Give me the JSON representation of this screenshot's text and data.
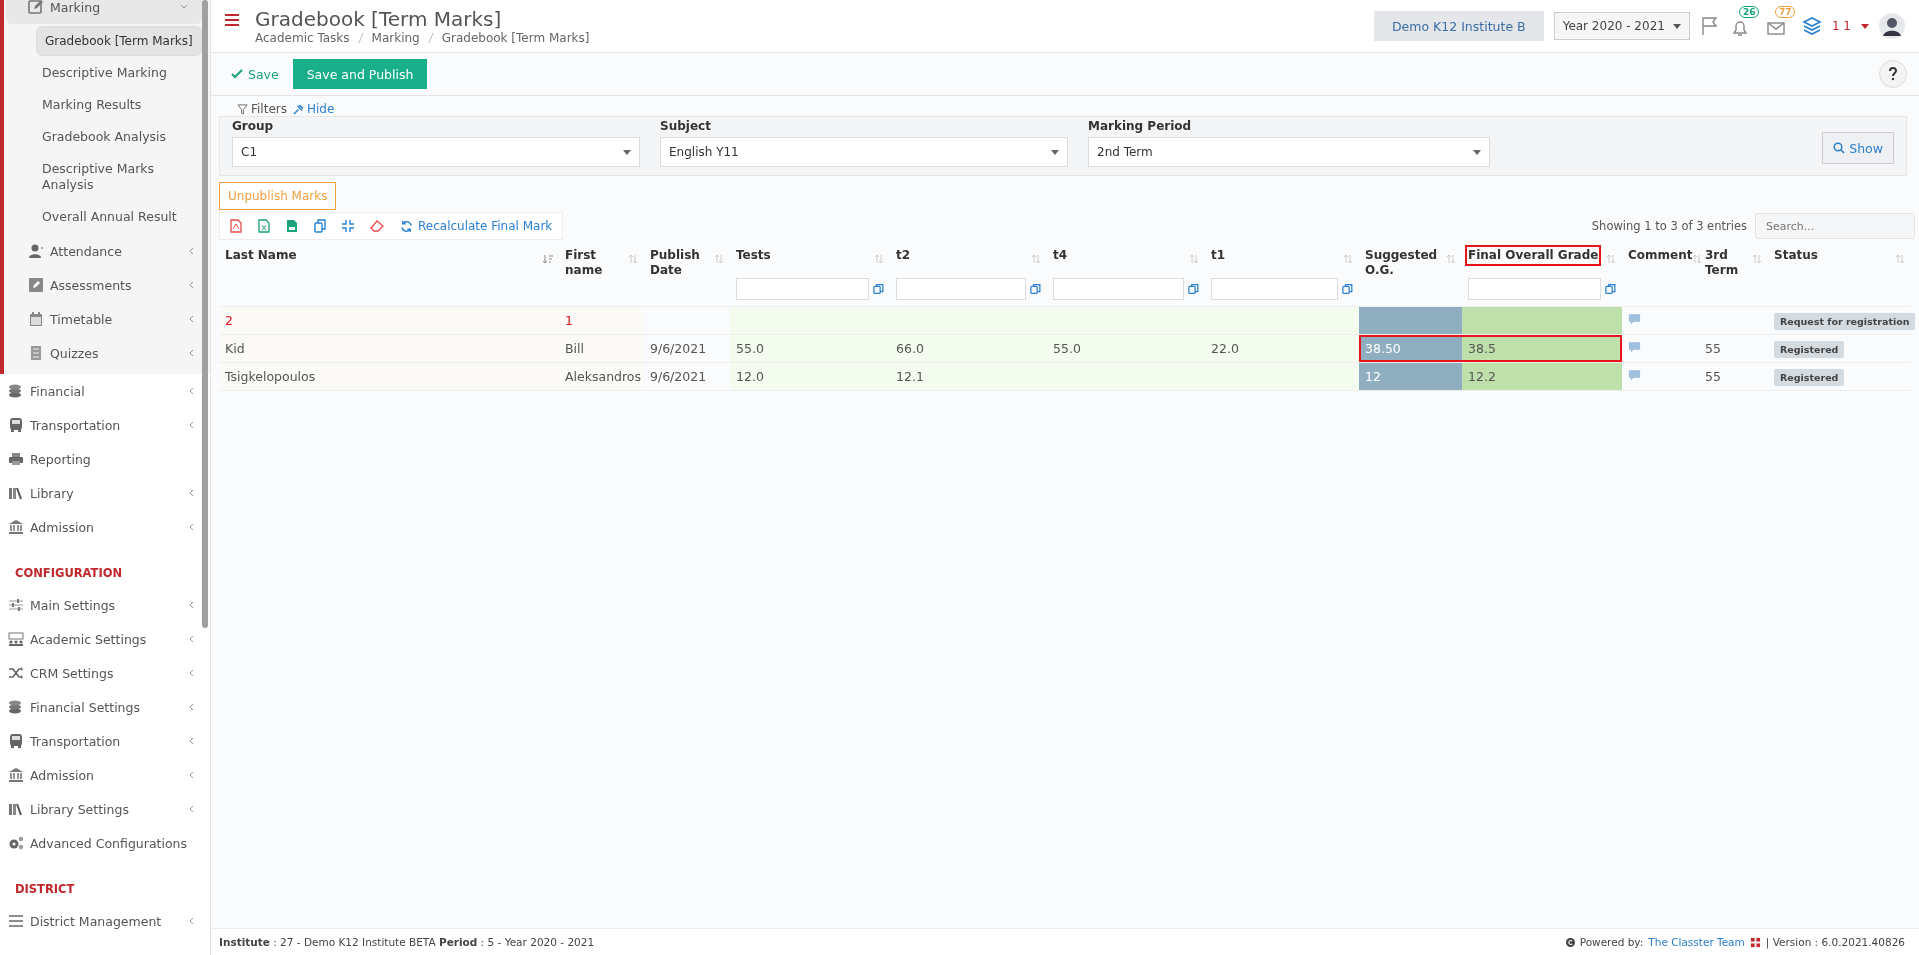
{
  "sidebar": {
    "open_group": {
      "items": [
        {
          "label": "Marking",
          "expandable": true,
          "expanded": true,
          "children": [
            {
              "label": "Gradebook [Term Marks]",
              "selected": true
            },
            {
              "label": "Descriptive Marking",
              "selected": false
            },
            {
              "label": "Marking Results",
              "selected": false
            },
            {
              "label": "Gradebook Analysis",
              "selected": false
            },
            {
              "label": "Descriptive Marks Analysis",
              "selected": false
            },
            {
              "label": "Overall Annual Result",
              "selected": false
            }
          ]
        },
        {
          "label": "Attendance",
          "expandable": true
        },
        {
          "label": "Assessments",
          "expandable": true
        },
        {
          "label": "Timetable",
          "expandable": true
        },
        {
          "label": "Quizzes",
          "expandable": true
        }
      ]
    },
    "items": [
      {
        "label": "Financial",
        "expandable": true
      },
      {
        "label": "Transportation",
        "expandable": true
      },
      {
        "label": "Reporting",
        "expandable": false
      },
      {
        "label": "Library",
        "expandable": true
      },
      {
        "label": "Admission",
        "expandable": true
      }
    ],
    "sections": [
      {
        "heading": "CONFIGURATION",
        "items": [
          {
            "label": "Main Settings",
            "expandable": true
          },
          {
            "label": "Academic Settings",
            "expandable": true
          },
          {
            "label": "CRM Settings",
            "expandable": true
          },
          {
            "label": "Financial Settings",
            "expandable": true
          },
          {
            "label": "Transportation",
            "expandable": true
          },
          {
            "label": "Admission",
            "expandable": true
          },
          {
            "label": "Library Settings",
            "expandable": true
          },
          {
            "label": "Advanced Configurations",
            "expandable": false
          }
        ]
      },
      {
        "heading": "DISTRICT",
        "items": [
          {
            "label": "District Management",
            "expandable": true
          }
        ]
      }
    ]
  },
  "header": {
    "title": "Gradebook [Term Marks]",
    "breadcrumbs": [
      "Academic Tasks",
      "Marking",
      "Gradebook [Term Marks]"
    ],
    "institute": "Demo K12 Institute B",
    "year": "Year 2020 - 2021",
    "notifications": [
      {
        "count": "26",
        "color": "#1aa37a"
      },
      {
        "count": "77",
        "color": "#f0a040"
      }
    ],
    "user": "1 1"
  },
  "toolbar": {
    "save": "Save",
    "save_publish": "Save and Publish"
  },
  "filters": {
    "label": "Filters",
    "hide": "Hide",
    "fields": [
      {
        "label": "Group",
        "value": "C1"
      },
      {
        "label": "Subject",
        "value": "English Y11"
      },
      {
        "label": "Marking Period",
        "value": "2nd Term"
      }
    ],
    "show": "Show"
  },
  "unpublish": "Unpublish Marks",
  "recalculate": "Recalculate Final Mark",
  "showing": "Showing 1 to 3 of 3 entries",
  "search": {
    "placeholder": "Search..."
  },
  "table": {
    "columns": [
      {
        "label": "Last Name",
        "sorted": true,
        "filter": false,
        "highlighted": false
      },
      {
        "label": "First name",
        "sorted": false,
        "filter": false,
        "highlighted": false
      },
      {
        "label": "Publish Date",
        "sorted": false,
        "filter": false,
        "highlighted": false
      },
      {
        "label": "Tests",
        "sorted": false,
        "filter": true,
        "highlighted": false
      },
      {
        "label": "t2",
        "sorted": false,
        "filter": true,
        "highlighted": false
      },
      {
        "label": "t4",
        "sorted": false,
        "filter": true,
        "highlighted": false
      },
      {
        "label": "t1",
        "sorted": false,
        "filter": true,
        "highlighted": false
      },
      {
        "label": "Suggested O.G.",
        "sorted": false,
        "filter": false,
        "highlighted": false
      },
      {
        "label": "Final Overall Grade",
        "sorted": false,
        "filter": true,
        "highlighted": true
      },
      {
        "label": "Comment",
        "sorted": false,
        "filter": false,
        "highlighted": false
      },
      {
        "label": "3rd Term",
        "sorted": false,
        "filter": false,
        "highlighted": false
      },
      {
        "label": "Status",
        "sorted": false,
        "filter": false,
        "highlighted": false
      }
    ],
    "rows": [
      {
        "kind": "summary",
        "highlighted": false,
        "last_name": "2",
        "first_name": "1",
        "publish_date": "",
        "tests": "",
        "t2": "",
        "t4": "",
        "t1": "",
        "suggested": "",
        "final": "",
        "third_term": "",
        "status": "Request for registration"
      },
      {
        "kind": "student",
        "highlighted": true,
        "last_name": "Kid",
        "first_name": "Bill",
        "publish_date": "9/6/2021",
        "tests": "55.0",
        "t2": "66.0",
        "t4": "55.0",
        "t1": "22.0",
        "suggested": "38.50",
        "final": "38.5",
        "third_term": "55",
        "status": "Registered"
      },
      {
        "kind": "student",
        "highlighted": false,
        "last_name": "Tsigkelopoulos",
        "first_name": "Aleksandros",
        "publish_date": "9/6/2021",
        "tests": "12.0",
        "t2": "12.1",
        "t4": "",
        "t1": "",
        "suggested": "12",
        "final": "12.2",
        "third_term": "55",
        "status": "Registered"
      }
    ]
  },
  "footer": {
    "info": "**Institute** : 27 - Demo K12 Institute BETA **Period** : 5 - Year 2020 - 2021",
    "powered": "Powered by:",
    "team": "The Classter Team",
    "version": "| Version : 6.0.2021.40826"
  }
}
